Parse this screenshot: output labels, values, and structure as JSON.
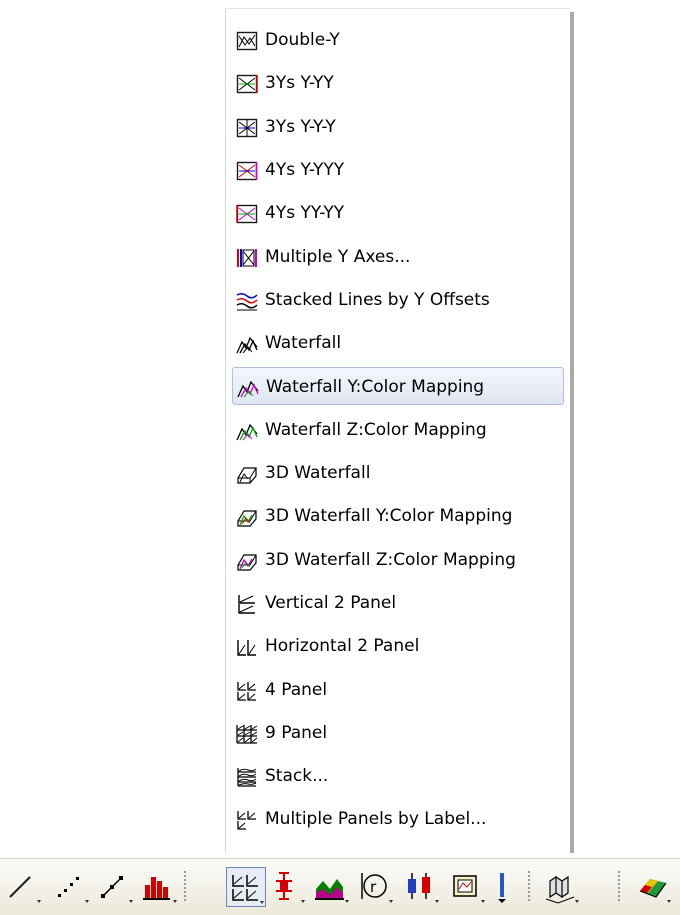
{
  "menu": {
    "items": [
      {
        "label": "Double-Y",
        "icon": "double-y-graph-icon"
      },
      {
        "label": "3Ys Y-YY",
        "icon": "three-y-yy-graph-icon"
      },
      {
        "label": "3Ys Y-Y-Y",
        "icon": "three-y-y-y-graph-icon"
      },
      {
        "label": "4Ys Y-YYY",
        "icon": "four-y-yyy-graph-icon"
      },
      {
        "label": "4Ys YY-YY",
        "icon": "four-yy-yy-graph-icon"
      },
      {
        "label": "Multiple Y Axes...",
        "icon": "multiple-y-axes-icon"
      },
      {
        "label": "Stacked Lines by Y Offsets",
        "icon": "stacked-lines-icon"
      },
      {
        "label": "Waterfall",
        "icon": "waterfall-icon"
      },
      {
        "label": "Waterfall Y:Color Mapping",
        "icon": "waterfall-y-color-icon"
      },
      {
        "label": "Waterfall Z:Color Mapping",
        "icon": "waterfall-z-color-icon"
      },
      {
        "label": "3D Waterfall",
        "icon": "3d-waterfall-icon"
      },
      {
        "label": "3D Waterfall Y:Color Mapping",
        "icon": "3d-waterfall-y-color-icon"
      },
      {
        "label": "3D Waterfall Z:Color Mapping",
        "icon": "3d-waterfall-z-color-icon"
      },
      {
        "label": "Vertical 2 Panel",
        "icon": "vertical-2-panel-icon"
      },
      {
        "label": "Horizontal 2 Panel",
        "icon": "horizontal-2-panel-icon"
      },
      {
        "label": "4 Panel",
        "icon": "4-panel-icon"
      },
      {
        "label": "9 Panel",
        "icon": "9-panel-icon"
      },
      {
        "label": "Stack...",
        "icon": "stack-icon"
      },
      {
        "label": "Multiple Panels by Label...",
        "icon": "multiple-panels-by-label-icon"
      }
    ],
    "highlighted": "Waterfall Y:Color Mapping"
  },
  "toolbar": {
    "buttons": [
      {
        "name": "line-graph-button",
        "icon": "line-icon"
      },
      {
        "name": "scatter-graph-button",
        "icon": "scatter-icon"
      },
      {
        "name": "line-symbol-graph-button",
        "icon": "line-symbol-icon"
      },
      {
        "name": "column-graph-button",
        "icon": "column-bars-icon"
      },
      {
        "name": "multi-panel-graph-button",
        "icon": "multi-panel-icon",
        "active": true
      },
      {
        "name": "error-bar-graph-button",
        "icon": "error-bar-icon"
      },
      {
        "name": "area-graph-button",
        "icon": "area-icon"
      },
      {
        "name": "polar-graph-button",
        "icon": "polar-icon"
      },
      {
        "name": "stock-graph-button",
        "icon": "candlestick-icon"
      },
      {
        "name": "template-graph-button",
        "icon": "template-icon"
      },
      {
        "name": "toolbar-overflow-button",
        "icon": "chevron-down-icon"
      },
      {
        "name": "3d-bar-graph-button",
        "icon": "3d-bars-icon"
      },
      {
        "name": "3d-surface-graph-button",
        "icon": "3d-surface-icon"
      }
    ],
    "colors": {
      "red": "#d40000",
      "green": "#008000",
      "blue": "#1f3fbf",
      "menu_highlight": "#dfe6f2"
    }
  }
}
